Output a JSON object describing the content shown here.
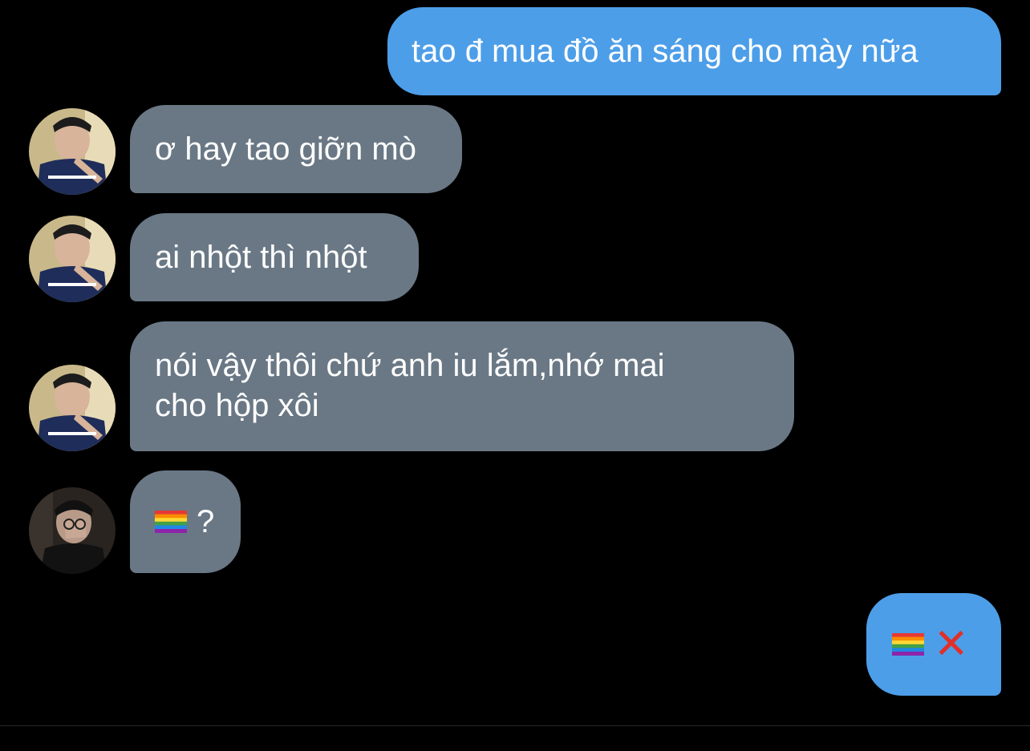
{
  "messages": [
    {
      "side": "sent",
      "text": "tao đ mua đồ ăn sáng cho mày nữa"
    },
    {
      "side": "received",
      "avatar": "avatar-guy-pointing",
      "text": "ơ hay tao giỡn mò"
    },
    {
      "side": "received",
      "avatar": "avatar-guy-pointing",
      "text": "ai nhột thì nhột"
    },
    {
      "side": "received",
      "avatar": "avatar-guy-pointing",
      "text": "nói vậy thôi chứ anh iu lắm,nhớ mai\ncho hộp xôi"
    },
    {
      "side": "received",
      "avatar": "avatar-guy-covering-face",
      "text": "?",
      "icon": "rainbow-flag-icon"
    },
    {
      "side": "sent",
      "icons": [
        "rainbow-flag-icon",
        "cross-mark-icon"
      ],
      "cross_glyph": "✕"
    }
  ],
  "colors": {
    "background": "#000000",
    "sent_bubble": "#4d9ee8",
    "received_bubble": "#6a7885",
    "text": "#ffffff",
    "cross_mark": "#e0302a"
  }
}
